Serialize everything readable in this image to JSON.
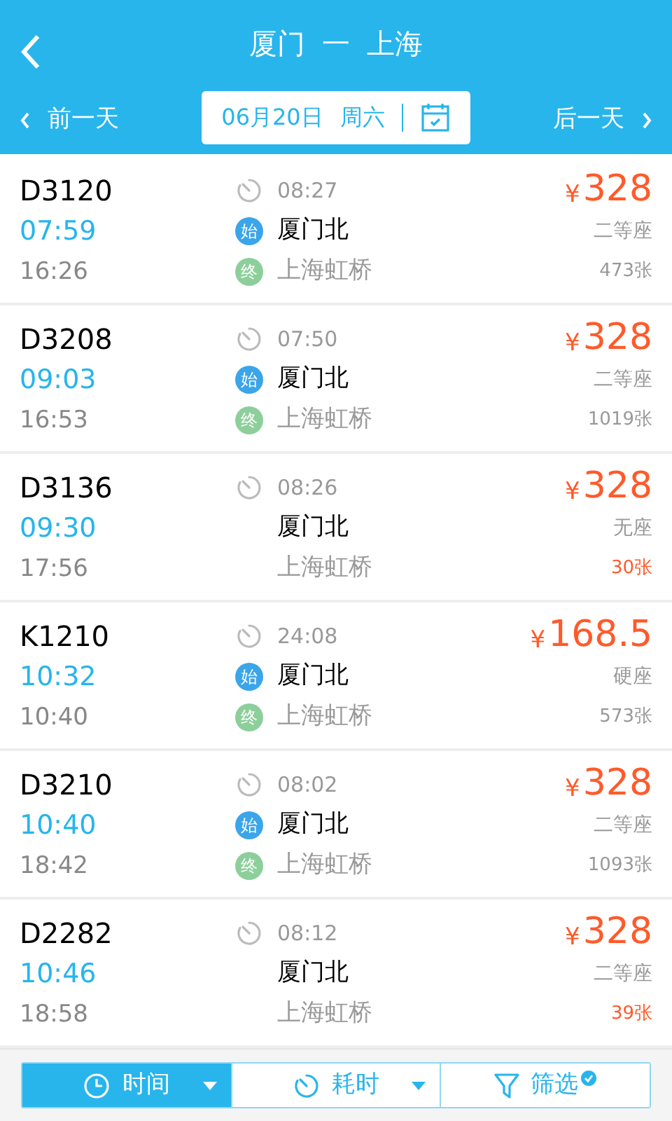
{
  "header": {
    "title_from": "厦门",
    "title_arrow": "一",
    "title_to": "上海"
  },
  "date_bar": {
    "prev": "前一天",
    "date": "06月20日",
    "weekday": "周六",
    "next": "后一天"
  },
  "trains": [
    {
      "number": "D3120",
      "depart": "07:59",
      "arrive": "16:26",
      "duration": "08:27",
      "start_badge": "始",
      "from": "厦门北",
      "end_badge": "终",
      "to": "上海虹桥",
      "currency": "¥",
      "price": "328",
      "seat": "二等座",
      "tickets": "473张",
      "scarce": false
    },
    {
      "number": "D3208",
      "depart": "09:03",
      "arrive": "16:53",
      "duration": "07:50",
      "start_badge": "始",
      "from": "厦门北",
      "end_badge": "终",
      "to": "上海虹桥",
      "currency": "¥",
      "price": "328",
      "seat": "二等座",
      "tickets": "1019张",
      "scarce": false
    },
    {
      "number": "D3136",
      "depart": "09:30",
      "arrive": "17:56",
      "duration": "08:26",
      "from": "厦门北",
      "to": "上海虹桥",
      "currency": "¥",
      "price": "328",
      "seat": "无座",
      "tickets": "30张",
      "scarce": true
    },
    {
      "number": "K1210",
      "depart": "10:32",
      "arrive": "10:40",
      "duration": "24:08",
      "start_badge": "始",
      "from": "厦门北",
      "end_badge": "终",
      "to": "上海虹桥",
      "currency": "¥",
      "price": "168.5",
      "seat": "硬座",
      "tickets": "573张",
      "scarce": false
    },
    {
      "number": "D3210",
      "depart": "10:40",
      "arrive": "18:42",
      "duration": "08:02",
      "start_badge": "始",
      "from": "厦门北",
      "end_badge": "终",
      "to": "上海虹桥",
      "currency": "¥",
      "price": "328",
      "seat": "二等座",
      "tickets": "1093张",
      "scarce": false
    },
    {
      "number": "D2282",
      "depart": "10:46",
      "arrive": "18:58",
      "duration": "08:12",
      "from": "厦门北",
      "to": "上海虹桥",
      "currency": "¥",
      "price": "328",
      "seat": "二等座",
      "tickets": "39张",
      "scarce": true
    }
  ],
  "sort_bar": [
    {
      "kind": "time",
      "label": "时间",
      "selected": true,
      "dropdown": true
    },
    {
      "kind": "duration",
      "label": "耗时",
      "selected": false,
      "dropdown": true
    },
    {
      "kind": "filter",
      "label": "筛选",
      "selected": false,
      "dropdown": false,
      "checked": true
    }
  ]
}
